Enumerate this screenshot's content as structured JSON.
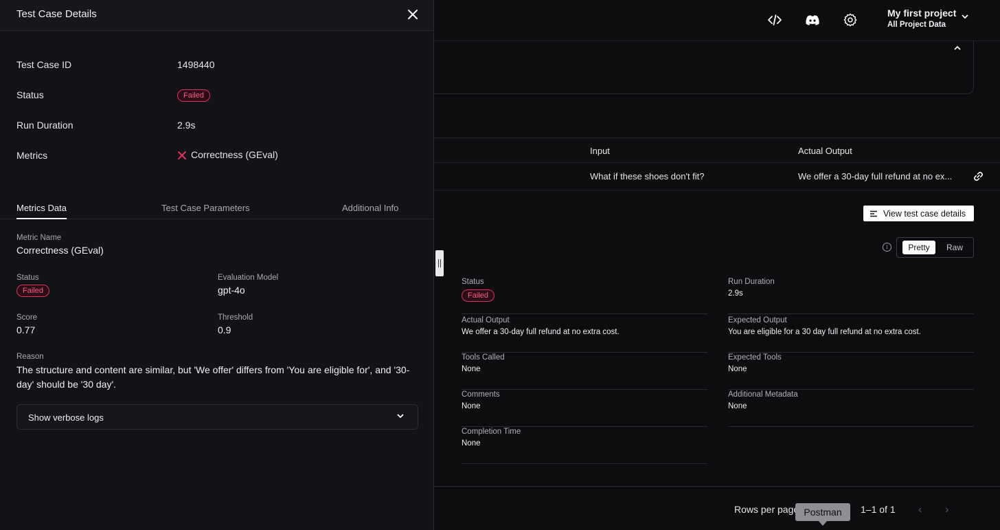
{
  "header": {
    "project_name": "My first project",
    "project_sub": "All Project Data"
  },
  "table": {
    "columns": [
      "Input",
      "Actual Output"
    ],
    "row": {
      "input": "What if these shoes don't fit?",
      "actual_output": "We offer a 30-day full refund at no ex..."
    }
  },
  "details": {
    "view_button": "View test case details",
    "toggle": {
      "pretty": "Pretty",
      "raw": "Raw"
    },
    "fields": [
      {
        "label": "Status",
        "value": "Failed",
        "badge": true
      },
      {
        "label": "Run Duration",
        "value": "2.9s"
      },
      {
        "label": "Actual Output",
        "value": "We offer a 30-day full refund at no extra cost."
      },
      {
        "label": "Expected Output",
        "value": "You are eligible for a 30 day full refund at no extra cost."
      },
      {
        "label": "Tools Called",
        "value": "None"
      },
      {
        "label": "Expected Tools",
        "value": "None"
      },
      {
        "label": "Comments",
        "value": "None"
      },
      {
        "label": "Additional Metadata",
        "value": "None"
      },
      {
        "label": "Completion Time",
        "value": "None"
      }
    ]
  },
  "pagination": {
    "rows_per_page": "Rows per page",
    "range": "1–1 of 1",
    "tooltip": "Postman"
  },
  "drawer": {
    "title": "Test Case Details",
    "summary": {
      "id_label": "Test Case ID",
      "id_value": "1498440",
      "status_label": "Status",
      "status_value": "Failed",
      "duration_label": "Run Duration",
      "duration_value": "2.9s",
      "metrics_label": "Metrics",
      "metrics_value": "Correctness (GEval)"
    },
    "tabs": [
      "Metrics Data",
      "Test Case Parameters",
      "Additional Info"
    ],
    "metric": {
      "name_label": "Metric Name",
      "name_value": "Correctness (GEval)",
      "status_label": "Status",
      "status_value": "Failed",
      "model_label": "Evaluation Model",
      "model_value": "gpt-4o",
      "score_label": "Score",
      "score_value": "0.77",
      "threshold_label": "Threshold",
      "threshold_value": "0.9",
      "reason_label": "Reason",
      "reason_value": "The structure and content are similar, but 'We offer' differs from 'You are eligible for', and '30-day' should be '30 day'."
    },
    "verbose_label": "Show verbose logs"
  },
  "colors": {
    "failed": "#e0315f",
    "accent_white": "#ffffff"
  }
}
